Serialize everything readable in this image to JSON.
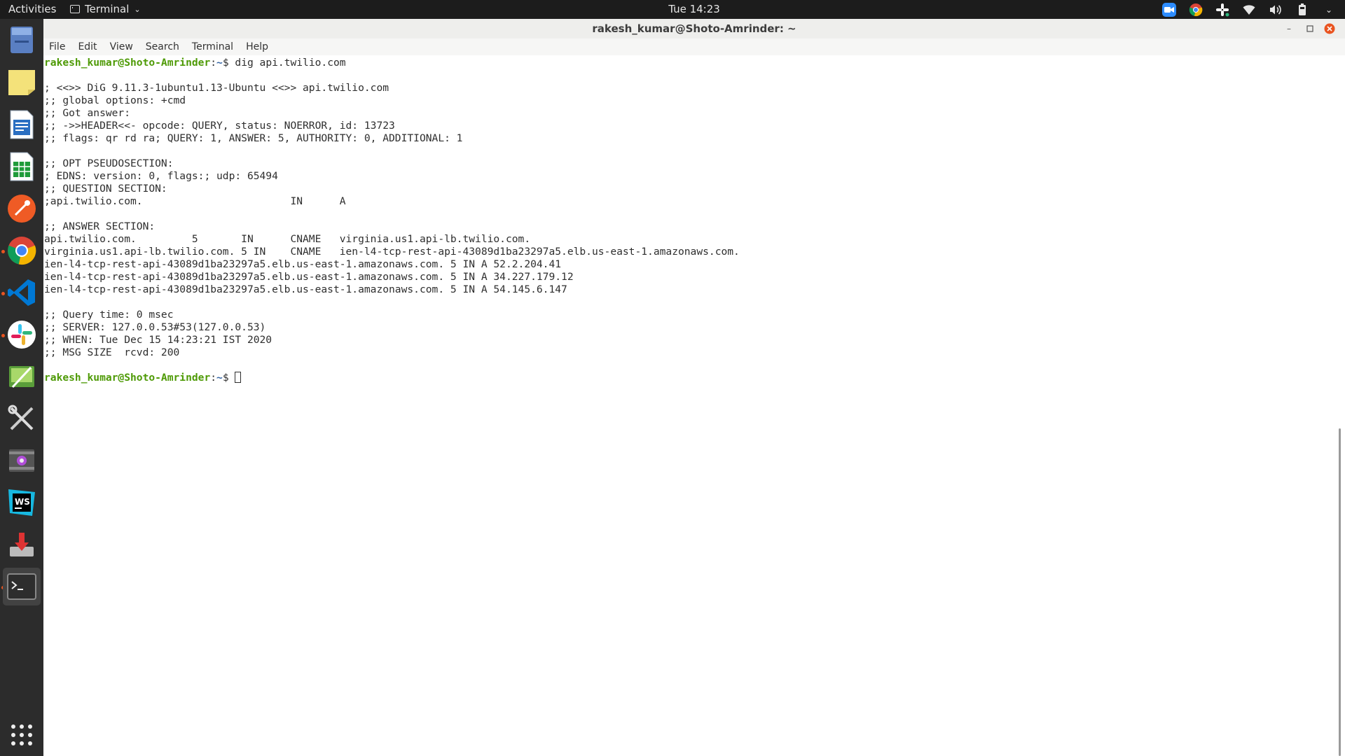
{
  "topbar": {
    "activities": "Activities",
    "app_name": "Terminal",
    "clock": "Tue 14:23"
  },
  "window": {
    "title": "rakesh_kumar@Shoto-Amrinder: ~"
  },
  "menubar": [
    "File",
    "Edit",
    "View",
    "Search",
    "Terminal",
    "Help"
  ],
  "dock": {
    "items": [
      {
        "name": "files",
        "running": false
      },
      {
        "name": "sticky-notes",
        "running": false
      },
      {
        "name": "libreoffice-writer",
        "running": false
      },
      {
        "name": "libreoffice-calc",
        "running": false
      },
      {
        "name": "postman",
        "running": false
      },
      {
        "name": "chrome",
        "running": true
      },
      {
        "name": "vscode",
        "running": true
      },
      {
        "name": "slack",
        "running": true
      },
      {
        "name": "kazam",
        "running": false
      },
      {
        "name": "system-tools",
        "running": false
      },
      {
        "name": "video-recorder",
        "running": false
      },
      {
        "name": "webstorm",
        "running": false
      },
      {
        "name": "installer",
        "running": false
      },
      {
        "name": "terminal",
        "running": true
      }
    ]
  },
  "terminal": {
    "prompt_user": "rakesh_kumar@Shoto-Amrinder",
    "prompt_path": "~",
    "command": "dig api.twilio.com",
    "output": [
      "",
      "; <<>> DiG 9.11.3-1ubuntu1.13-Ubuntu <<>> api.twilio.com",
      ";; global options: +cmd",
      ";; Got answer:",
      ";; ->>HEADER<<- opcode: QUERY, status: NOERROR, id: 13723",
      ";; flags: qr rd ra; QUERY: 1, ANSWER: 5, AUTHORITY: 0, ADDITIONAL: 1",
      "",
      ";; OPT PSEUDOSECTION:",
      "; EDNS: version: 0, flags:; udp: 65494",
      ";; QUESTION SECTION:",
      ";api.twilio.com.                        IN      A",
      "",
      ";; ANSWER SECTION:",
      "api.twilio.com.         5       IN      CNAME   virginia.us1.api-lb.twilio.com.",
      "virginia.us1.api-lb.twilio.com. 5 IN    CNAME   ien-l4-tcp-rest-api-43089d1ba23297a5.elb.us-east-1.amazonaws.com.",
      "ien-l4-tcp-rest-api-43089d1ba23297a5.elb.us-east-1.amazonaws.com. 5 IN A 52.2.204.41",
      "ien-l4-tcp-rest-api-43089d1ba23297a5.elb.us-east-1.amazonaws.com. 5 IN A 34.227.179.12",
      "ien-l4-tcp-rest-api-43089d1ba23297a5.elb.us-east-1.amazonaws.com. 5 IN A 54.145.6.147",
      "",
      ";; Query time: 0 msec",
      ";; SERVER: 127.0.0.53#53(127.0.0.53)",
      ";; WHEN: Tue Dec 15 14:23:21 IST 2020",
      ";; MSG SIZE  rcvd: 200",
      ""
    ]
  },
  "colors": {
    "prompt_user": "#4e9a06",
    "prompt_path": "#3465a4",
    "close_button": "#e95420"
  }
}
